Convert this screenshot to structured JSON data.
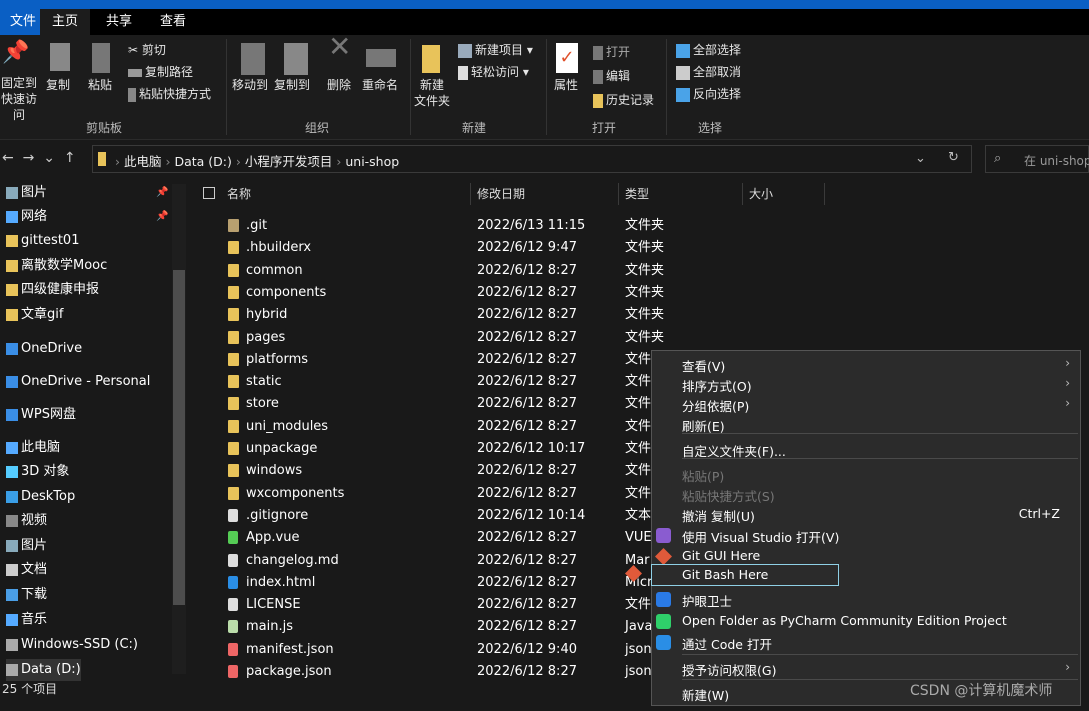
{
  "tabs": [
    "文件",
    "主页",
    "共享",
    "查看"
  ],
  "ribbon": {
    "pin": "固定到\n快速访问",
    "copy": "复制",
    "paste": "粘贴",
    "cut": "剪切",
    "copy_path": "复制路径",
    "paste_shortcut": "粘贴快捷方式",
    "move_to": "移动到",
    "copy_to": "复制到",
    "delete": "删除",
    "rename": "重命名",
    "new_folder": "新建\n文件夹",
    "new_item": "新建项目",
    "easy_access": "轻松访问",
    "properties": "属性",
    "open": "打开",
    "edit": "编辑",
    "history": "历史记录",
    "select_all": "全部选择",
    "select_none": "全部取消",
    "invert": "反向选择",
    "groups": [
      "剪贴板",
      "组织",
      "新建",
      "打开",
      "选择"
    ]
  },
  "address": {
    "crumbs": [
      "此电脑",
      "Data (D:)",
      "小程序开发项目",
      "uni-shop"
    ],
    "search_placeholder": "在 uni-shop"
  },
  "sidebar": [
    "图片",
    "网络",
    "gittest01",
    "离散数学Mooc",
    "四级健康申报",
    "文章gif",
    "OneDrive",
    "OneDrive - Personal",
    "WPS网盘",
    "此电脑",
    "3D 对象",
    "DeskTop",
    "视频",
    "图片",
    "文档",
    "下载",
    "音乐",
    "Windows-SSD (C:)",
    "Data (D:)"
  ],
  "columns": [
    "名称",
    "修改日期",
    "类型",
    "大小"
  ],
  "files": [
    {
      "name": ".git",
      "date": "2022/6/13 11:15",
      "type": "文件夹"
    },
    {
      "name": ".hbuilderx",
      "date": "2022/6/12 9:47",
      "type": "文件夹"
    },
    {
      "name": "common",
      "date": "2022/6/12 8:27",
      "type": "文件夹"
    },
    {
      "name": "components",
      "date": "2022/6/12 8:27",
      "type": "文件夹"
    },
    {
      "name": "hybrid",
      "date": "2022/6/12 8:27",
      "type": "文件夹"
    },
    {
      "name": "pages",
      "date": "2022/6/12 8:27",
      "type": "文件夹"
    },
    {
      "name": "platforms",
      "date": "2022/6/12 8:27",
      "type": "文件"
    },
    {
      "name": "static",
      "date": "2022/6/12 8:27",
      "type": "文件"
    },
    {
      "name": "store",
      "date": "2022/6/12 8:27",
      "type": "文件"
    },
    {
      "name": "uni_modules",
      "date": "2022/6/12 8:27",
      "type": "文件"
    },
    {
      "name": "unpackage",
      "date": "2022/6/12 10:17",
      "type": "文件"
    },
    {
      "name": "windows",
      "date": "2022/6/12 8:27",
      "type": "文件"
    },
    {
      "name": "wxcomponents",
      "date": "2022/6/12 8:27",
      "type": "文件"
    },
    {
      "name": ".gitignore",
      "date": "2022/6/12 10:14",
      "type": "文本"
    },
    {
      "name": "App.vue",
      "date": "2022/6/12 8:27",
      "type": "VUE"
    },
    {
      "name": "changelog.md",
      "date": "2022/6/12 8:27",
      "type": "Mar"
    },
    {
      "name": "index.html",
      "date": "2022/6/12 8:27",
      "type": "Micr"
    },
    {
      "name": "LICENSE",
      "date": "2022/6/12 8:27",
      "type": "文件"
    },
    {
      "name": "main.js",
      "date": "2022/6/12 8:27",
      "type": "Java"
    },
    {
      "name": "manifest.json",
      "date": "2022/6/12 9:40",
      "type": "json"
    },
    {
      "name": "package.json",
      "date": "2022/6/12 8:27",
      "type": "json"
    }
  ],
  "menu": [
    {
      "label": "查看(V)",
      "sub": true
    },
    {
      "label": "排序方式(O)",
      "sub": true
    },
    {
      "label": "分组依据(P)",
      "sub": true
    },
    {
      "label": "刷新(E)"
    },
    {
      "label": "自定义文件夹(F)..."
    },
    {
      "label": "粘贴(P)",
      "disabled": true
    },
    {
      "label": "粘贴快捷方式(S)",
      "disabled": true
    },
    {
      "label": "撤消 复制(U)",
      "shortcut": "Ctrl+Z"
    },
    {
      "label": "使用 Visual Studio 打开(V)",
      "icon": "visual-studio-icon"
    },
    {
      "label": "Git GUI Here",
      "icon": "git-icon"
    },
    {
      "label": "Git Bash Here",
      "icon": "git-icon"
    },
    {
      "label": "护眼卫士",
      "icon": "eye-guard-icon"
    },
    {
      "label": "Open Folder as PyCharm Community Edition Project",
      "icon": "pycharm-icon"
    },
    {
      "label": "通过 Code 打开",
      "icon": "vscode-icon"
    },
    {
      "label": "授予访问权限(G)",
      "sub": true
    },
    {
      "label": "新建(W)"
    }
  ],
  "status": "25 个项目",
  "watermark": "CSDN @计算机魔术师",
  "colors": {
    "accent": "#0a5fc4",
    "highlight": "#8fd0e6",
    "folder": "#e8c35a"
  }
}
